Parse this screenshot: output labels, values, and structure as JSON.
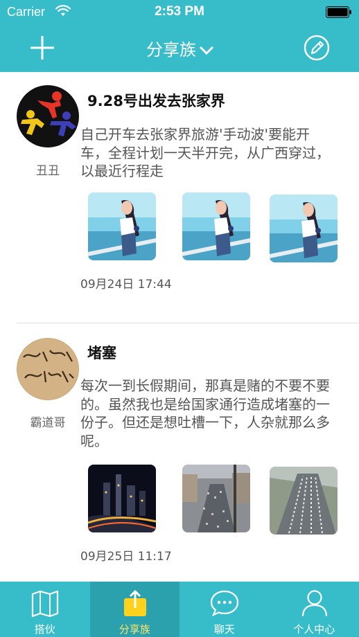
{
  "status_bar": {
    "carrier": "Carrier",
    "time": "2:53 PM"
  },
  "nav": {
    "title": "分享族",
    "add_icon": "plus-icon",
    "edit_icon": "edit-icon"
  },
  "posts": [
    {
      "author": "丑丑",
      "title": "9.28号出发去张家界",
      "body_lines": [
        "自己开车去张家界旅游'手动波'要能开",
        "车，全程计划一天半开完，从广西穿过，",
        "以最近行程走"
      ],
      "time": "09月24日 17:44"
    },
    {
      "author": "霸道哥",
      "title": "堵塞",
      "body_lines": [
        "每次一到长假期间，那真是赌的不要不要",
        "的。虽然我也是给国家通行造成堵塞的一",
        "份子。但还是想吐槽一下，人杂就那么多",
        "呢。"
      ],
      "time": "09月25日 11:17"
    }
  ],
  "tabs": [
    {
      "label": "搭伙",
      "icon": "map-icon"
    },
    {
      "label": "分享族",
      "icon": "share-icon"
    },
    {
      "label": "聊天",
      "icon": "chat-icon"
    },
    {
      "label": "个人中心",
      "icon": "person-icon"
    }
  ],
  "colors": {
    "bar": "#37bdc9",
    "active_tab": "#2aa1ad",
    "active_label": "#ffe56a"
  }
}
